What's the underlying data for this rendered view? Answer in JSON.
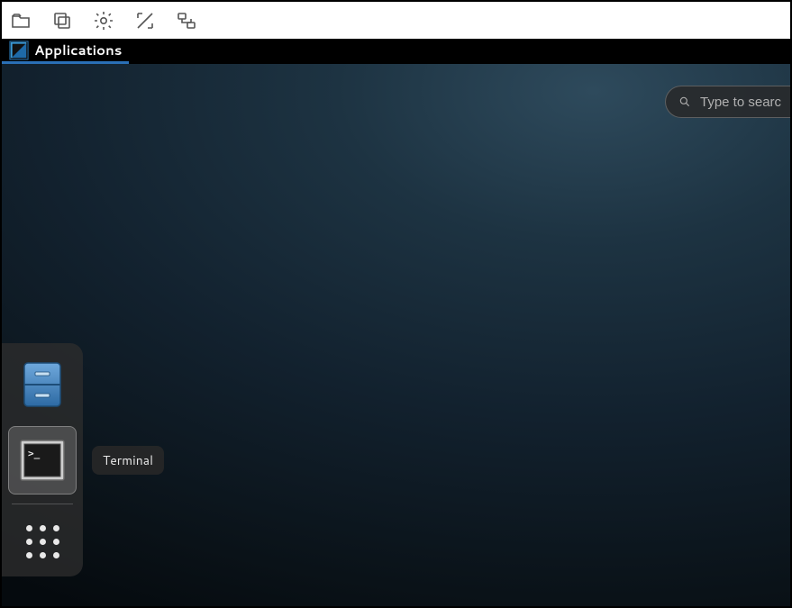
{
  "toolbar": {
    "items": [
      "open-folder",
      "copy",
      "settings",
      "fullscreen",
      "network"
    ]
  },
  "menubar": {
    "applications_label": "Applications"
  },
  "search": {
    "placeholder": "Type to search"
  },
  "dash": {
    "items": [
      {
        "id": "files",
        "name": "Files",
        "selected": false
      },
      {
        "id": "terminal",
        "name": "Terminal",
        "selected": true
      }
    ],
    "show_apps_label": "Show Applications"
  },
  "tooltip": {
    "text": "Terminal"
  }
}
